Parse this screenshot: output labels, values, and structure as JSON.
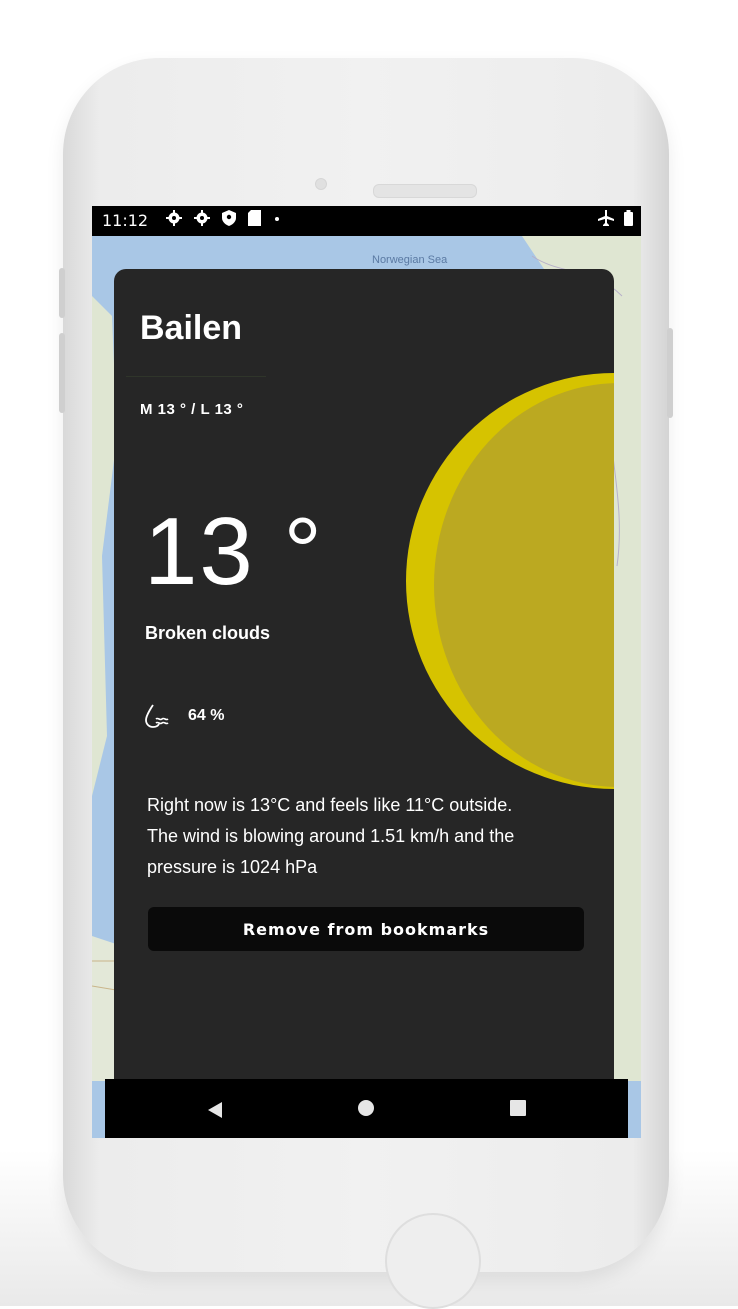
{
  "status_bar": {
    "time": "11:12",
    "left_icons": [
      "gear-icon",
      "gear-icon",
      "shield-icon",
      "sd-card-icon",
      "notification-dot-icon"
    ],
    "right_icons": [
      "airplane-mode-icon",
      "battery-icon"
    ]
  },
  "map": {
    "sea_label": "Norwegian Sea"
  },
  "weather_card": {
    "city": "Bailen",
    "min_max": "M 13 ° / L 13 °",
    "temperature": "13 °",
    "description": "Broken clouds",
    "humidity": "64 %",
    "humidity_icon": "humidity-icon",
    "summary_line1": "Right now is 13°C and feels like 11°C outside.",
    "summary_line2": "The wind is blowing around 1.51 km/h and the",
    "summary_line3": "pressure is 1024 hPa",
    "bookmark_button": "Remove from bookmarks",
    "sun_icon": "sun-icon",
    "colors": {
      "card_background": "#262626",
      "sun_outer": "#d6c300",
      "sun_inner": "#bba921",
      "button_background": "#0a0a0a"
    }
  },
  "nav_bar": {
    "buttons": [
      "back-icon",
      "home-icon",
      "recent-apps-icon"
    ]
  }
}
